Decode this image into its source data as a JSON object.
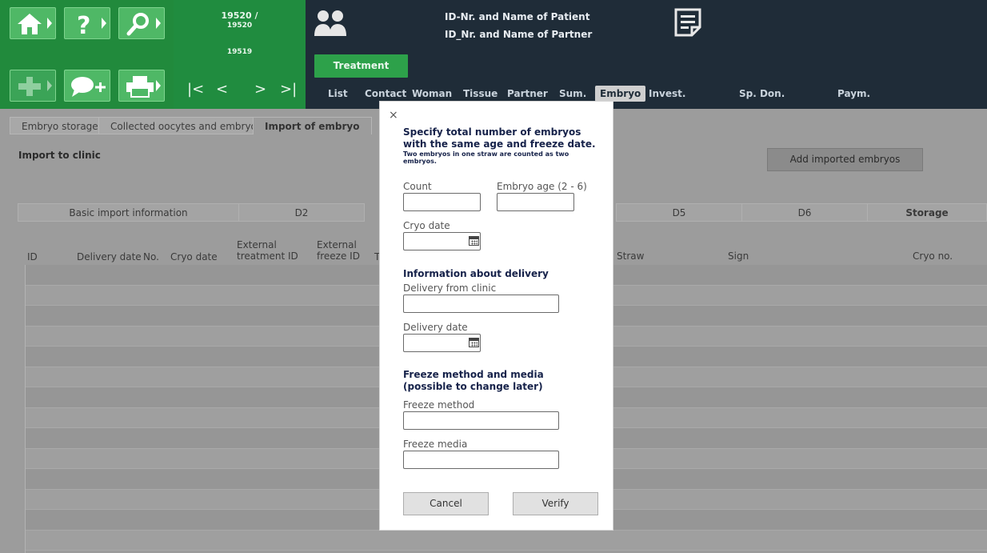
{
  "header": {
    "patient_ids": {
      "primary": "19520 /",
      "secondary": "19520",
      "partner": "19519"
    },
    "patient_label": "ID-Nr. and Name of Patient",
    "partner_label": "ID_Nr. and Name of Partner",
    "treatment_button": "Treatment",
    "nav_arrows": {
      "first": "|<",
      "prev": "<",
      "next": ">",
      "last": ">|"
    },
    "tabs": [
      "List",
      "Contact",
      "Woman",
      "Tissue",
      "Partner",
      "Sum.",
      "Embryo",
      "Invest.",
      "Sp. Don.",
      "Paym."
    ],
    "active_tab": "Embryo",
    "colors": {
      "green": "#218a3c",
      "dark": "#1f2c38"
    }
  },
  "subtabs": [
    "Embryo storage",
    "Collected oocytes and embryos",
    "Import of embryo"
  ],
  "active_subtab": "Import of embryo",
  "section_title": "Import to clinic",
  "add_button": "Add imported embryos",
  "group_headers": [
    "Basic import information",
    "D2",
    "D5",
    "D6",
    "Storage"
  ],
  "columns": {
    "id": "ID",
    "delivery_date": "Delivery date",
    "no": "No.",
    "cryo_date": "Cryo date",
    "ext_treatment_id": "External treatment ID",
    "ext_freeze_id": "External freeze ID",
    "t": "T",
    "straw": "Straw",
    "sign": "Sign",
    "cryo_no": "Cryo no."
  },
  "modal": {
    "close": "×",
    "title": "Specify total number of embryos with the same age and freeze date.",
    "subtitle": "Two embryos in one straw are counted as two embryos.",
    "count_label": "Count",
    "age_label": "Embryo age (2 - 6)",
    "cryo_date_label": "Cryo date",
    "delivery_section": "Information about delivery",
    "delivery_clinic_label": "Delivery from clinic",
    "delivery_date_label": "Delivery date",
    "freeze_section": "Freeze method and media (possible to change later)",
    "freeze_method_label": "Freeze method",
    "freeze_media_label": "Freeze media",
    "cancel": "Cancel",
    "verify": "Verify"
  }
}
